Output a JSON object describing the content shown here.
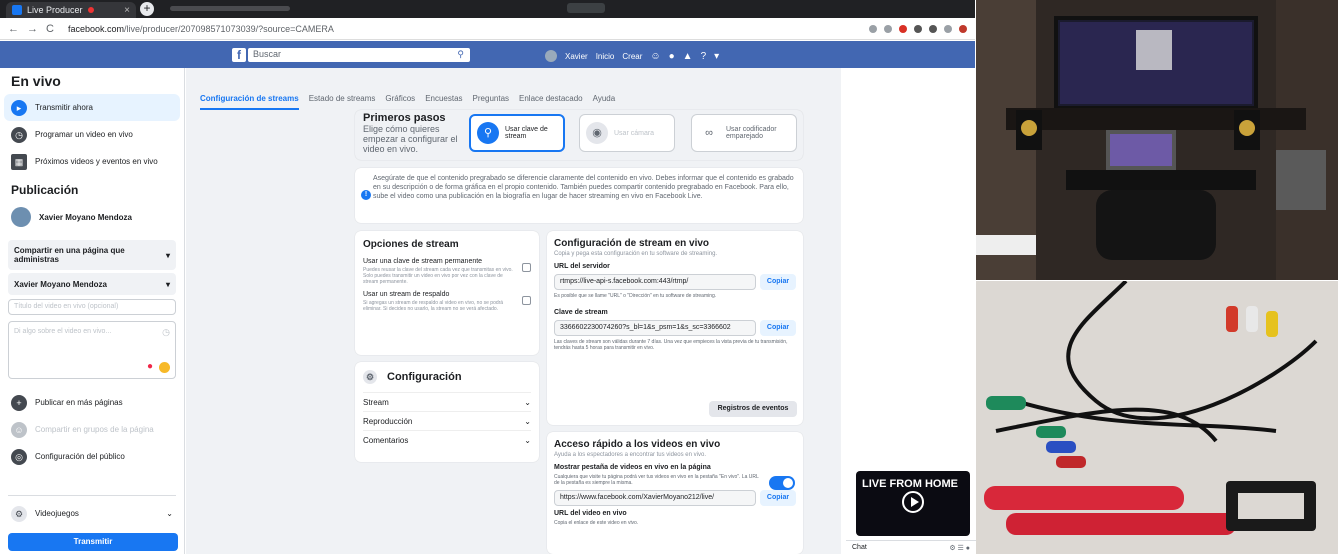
{
  "browser": {
    "tab_title": "Live Producer",
    "url_host": "facebook.com",
    "url_path": "/live/producer/207098571073039/?source=CAMERA"
  },
  "fb_header": {
    "logo": "f",
    "search_placeholder": "Buscar",
    "user": "Xavier",
    "nav": [
      "Inicio",
      "Crear"
    ]
  },
  "sidebar": {
    "title": "En vivo",
    "live_items": [
      {
        "label": "Transmitir ahora",
        "icon": "camera-icon"
      },
      {
        "label": "Programar un video en vivo",
        "icon": "clock-icon"
      },
      {
        "label": "Próximos videos y eventos en vivo",
        "icon": "calendar-icon"
      }
    ],
    "publication_title": "Publicación",
    "profile_name": "Xavier Moyano Mendoza",
    "share_select": "Compartir en una página que administras",
    "page_select": "Xavier Moyano Mendoza",
    "title_placeholder": "Título del video en vivo (opcional)",
    "description_placeholder": "Di algo sobre el video en vivo...",
    "actions": [
      {
        "label": "Publicar en más páginas",
        "icon": "share-icon"
      },
      {
        "label": "Compartir en grupos de la página",
        "icon": "group-icon"
      },
      {
        "label": "Configuración del público",
        "icon": "globe-icon"
      }
    ],
    "games_label": "Videojuegos",
    "transmit_button": "Transmitir"
  },
  "tabs": [
    "Configuración de streams",
    "Estado de streams",
    "Gráficos",
    "Encuestas",
    "Preguntas",
    "Enlace destacado",
    "Ayuda"
  ],
  "first_steps": {
    "title": "Primeros pasos",
    "subtitle": "Elige cómo quieres empezar a configurar el video en vivo.",
    "options": [
      "Usar clave de stream",
      "Usar cámara",
      "Usar codificador emparejado"
    ]
  },
  "notice": "Asegúrate de que el contenido pregrabado se diferencie claramente del contenido en vivo. Debes informar que el contenido es grabado en su descripción o de forma gráfica en el propio contenido. También puedes compartir contenido pregrabado en Facebook. Para ello, sube el video como una publicación en la biografía en lugar de hacer streaming en vivo en Facebook Live.",
  "stream_options": {
    "title": "Opciones de stream",
    "items": [
      {
        "title": "Usar una clave de stream permanente",
        "desc": "Puedes reusar la clave del stream cada vez que transmitas en vivo. Solo puedes transmitir un video en vivo por vez con la clave de stream permanente."
      },
      {
        "title": "Usar un stream de respaldo",
        "desc": "Si agregas un stream de respaldo al video en vivo, no se podrá eliminar. Si decides no usarlo, la stream no se verá afectado."
      }
    ]
  },
  "config": {
    "title": "Configuración",
    "sections": [
      "Stream",
      "Reproducción",
      "Comentarios"
    ]
  },
  "live_config": {
    "title": "Configuración de stream en vivo",
    "subtitle": "Copia y pega esta configuración en tu software de streaming.",
    "server_label": "URL del servidor",
    "server_value": "rtmps://live-api-s.facebook.com:443/rtmp/",
    "server_hint": "Es posible que se llame \"URL\" o \"Dirección\" en tu software de streaming.",
    "key_label": "Clave de stream",
    "key_value": "3366602230074260?s_bl=1&s_psm=1&s_sc=3366602",
    "key_hint": "Las claves de stream son válidas durante 7 días. Una vez que empieces la vista previa de tu transmisión, tendrás hasta 5 horas para transmitir en vivo.",
    "copy_label": "Copiar",
    "events_button": "Registros de eventos"
  },
  "quick_access": {
    "title": "Acceso rápido a los videos en vivo",
    "subtitle": "Ayuda a los espectadores a encontrar tus videos en vivo.",
    "tab_label": "Mostrar pestaña de videos en vivo en la página",
    "tab_desc": "Cualquiera que visite tu página podrá ver tus videos en vivo en la pestaña \"En vivo\". La URL de la pestaña es siempre la misma.",
    "tab_url": "https://www.facebook.com/XavierMoyano212/live/",
    "video_url_label": "URL del video en vivo",
    "video_url_desc": "Copia el enlace de este video en vivo.",
    "copy_label": "Copiar"
  },
  "preview": {
    "title": "LIVE FROM HOME",
    "chat_label": "Chat"
  }
}
